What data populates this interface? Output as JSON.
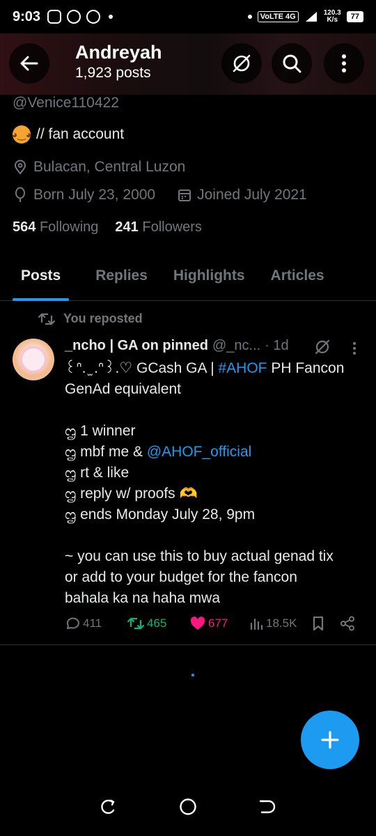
{
  "status_bar": {
    "time": "9:03",
    "network": "VoLTE",
    "network_gen": "4G",
    "speed_value": "120.3",
    "speed_unit": "K/s",
    "battery": "77"
  },
  "header": {
    "name": "Andreyah",
    "posts_count": "1,923 posts"
  },
  "profile": {
    "handle": "@Venice110422",
    "bio": "// fan account",
    "location": "Bulacan, Central Luzon",
    "born": "Born July 23, 2000",
    "joined": "Joined July 2021",
    "following_count": "564",
    "following_label": "Following",
    "followers_count": "241",
    "followers_label": "Followers"
  },
  "tabs": [
    {
      "label": "Posts",
      "active": true
    },
    {
      "label": "Replies",
      "active": false
    },
    {
      "label": "Highlights",
      "active": false
    },
    {
      "label": "Articles",
      "active": false
    }
  ],
  "post": {
    "repost_label": "You reposted",
    "author": "_ncho | GA on pinned",
    "handle": "@_nc...",
    "time": "· 1d",
    "line1_prefix": "꒰ᐢ. ̫ .ᐢ꒱.♡ GCash GA | ",
    "line1_hashtag": "#AHOF",
    "line1_suffix": " PH Fancon",
    "line2": "GenAd equivalent",
    "item1": "ᦗ 1 winner",
    "item2_prefix": "ᦗ mbf me & ",
    "item2_mention": "@AHOF_official",
    "item3": "ᦗ rt & like",
    "item4": "ᦗ reply w/ proofs 🫶",
    "item5": "ᦗ ends Monday July 28, 9pm",
    "para1": "~ you can use this to buy actual genad tix",
    "para2": "or add to your budget for the fancon",
    "para3": "bahala ka na haha mwa",
    "replies": "411",
    "reposts": "465",
    "likes": "677",
    "views": "18.5K"
  },
  "colors": {
    "accent": "#1d9bf0",
    "repost": "#00ba7c",
    "like": "#f91880",
    "muted": "#71767b",
    "background": "#000000"
  }
}
